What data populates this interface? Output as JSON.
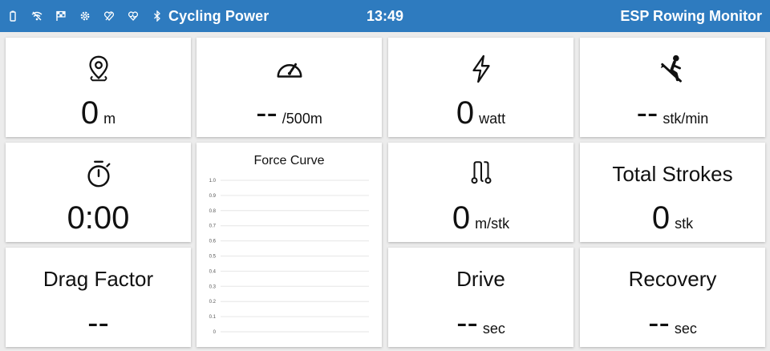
{
  "status_bar": {
    "icons": [
      "battery-icon",
      "wifi-off-icon",
      "flag-icon",
      "settings-icon",
      "heart-rate-off-icon",
      "heart-icon",
      "bluetooth-icon"
    ],
    "mode": "Cycling Power",
    "time": "13:49",
    "app_title": "ESP Rowing Monitor"
  },
  "tiles": {
    "distance": {
      "value": "0",
      "unit": "m",
      "icon": "location-pin-icon"
    },
    "pace": {
      "value": "--",
      "unit": "/500m",
      "icon": "speedometer-icon"
    },
    "power": {
      "value": "0",
      "unit": "watt",
      "icon": "lightning-icon"
    },
    "stroke_rate": {
      "value": "--",
      "unit": "stk/min",
      "icon": "rower-icon"
    },
    "elapsed": {
      "value": "0:00",
      "icon": "stopwatch-icon"
    },
    "distance_per_stroke": {
      "value": "0",
      "unit": "m/stk",
      "icon": "route-icon"
    },
    "total_strokes": {
      "title": "Total Strokes",
      "value": "0",
      "unit": "stk"
    },
    "drag_factor": {
      "title": "Drag Factor",
      "value": "--"
    },
    "drive": {
      "title": "Drive",
      "value": "--",
      "unit": "sec"
    },
    "recovery": {
      "title": "Recovery",
      "value": "--",
      "unit": "sec"
    }
  },
  "chart_data": {
    "type": "line",
    "title": "Force Curve",
    "xlabel": "",
    "ylabel": "",
    "ylim": [
      0,
      1.0
    ],
    "y_ticks": [
      "0",
      "0.1",
      "0.2",
      "0.3",
      "0.4",
      "0.5",
      "0.6",
      "0.7",
      "0.8",
      "0.9",
      "1.0"
    ],
    "grid": true,
    "series": []
  }
}
